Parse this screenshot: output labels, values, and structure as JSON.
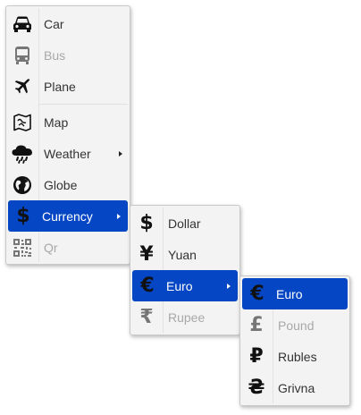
{
  "menu_main": {
    "items": [
      {
        "label": "Car",
        "icon": "car-icon",
        "disabled": false
      },
      {
        "label": "Bus",
        "icon": "bus-icon",
        "disabled": true
      },
      {
        "label": "Plane",
        "icon": "plane-icon",
        "disabled": false
      },
      {
        "label": "Map",
        "icon": "map-icon",
        "disabled": false
      },
      {
        "label": "Weather",
        "icon": "weather-icon",
        "disabled": false,
        "submenu": true
      },
      {
        "label": "Globe",
        "icon": "globe-icon",
        "disabled": false
      },
      {
        "label": "Currency",
        "icon": "dollar-icon",
        "disabled": false,
        "submenu": true,
        "active": true
      },
      {
        "label": "Qr",
        "icon": "qr-icon",
        "disabled": true
      }
    ]
  },
  "menu_currency": {
    "items": [
      {
        "label": "Dollar",
        "icon": "dollar-icon",
        "glyph": "$",
        "disabled": false
      },
      {
        "label": "Yuan",
        "icon": "yuan-icon",
        "glyph": "¥",
        "disabled": false
      },
      {
        "label": "Euro",
        "icon": "euro-icon",
        "glyph": "€",
        "disabled": false,
        "submenu": true,
        "active": true
      },
      {
        "label": "Rupee",
        "icon": "rupee-icon",
        "glyph": "₹",
        "disabled": true
      }
    ]
  },
  "menu_euro": {
    "items": [
      {
        "label": "Euro",
        "icon": "euro-icon",
        "glyph": "€",
        "disabled": false,
        "active": true
      },
      {
        "label": "Pound",
        "icon": "pound-icon",
        "glyph": "£",
        "disabled": true
      },
      {
        "label": "Rubles",
        "icon": "ruble-icon",
        "glyph": "₽",
        "disabled": false
      },
      {
        "label": "Grivna",
        "icon": "hryvnia-icon",
        "glyph": "₴",
        "disabled": false
      }
    ]
  },
  "colors": {
    "active_bg": "#0446c3",
    "menu_bg": "#f3f3f3",
    "disabled_text": "#a8a8a8"
  }
}
